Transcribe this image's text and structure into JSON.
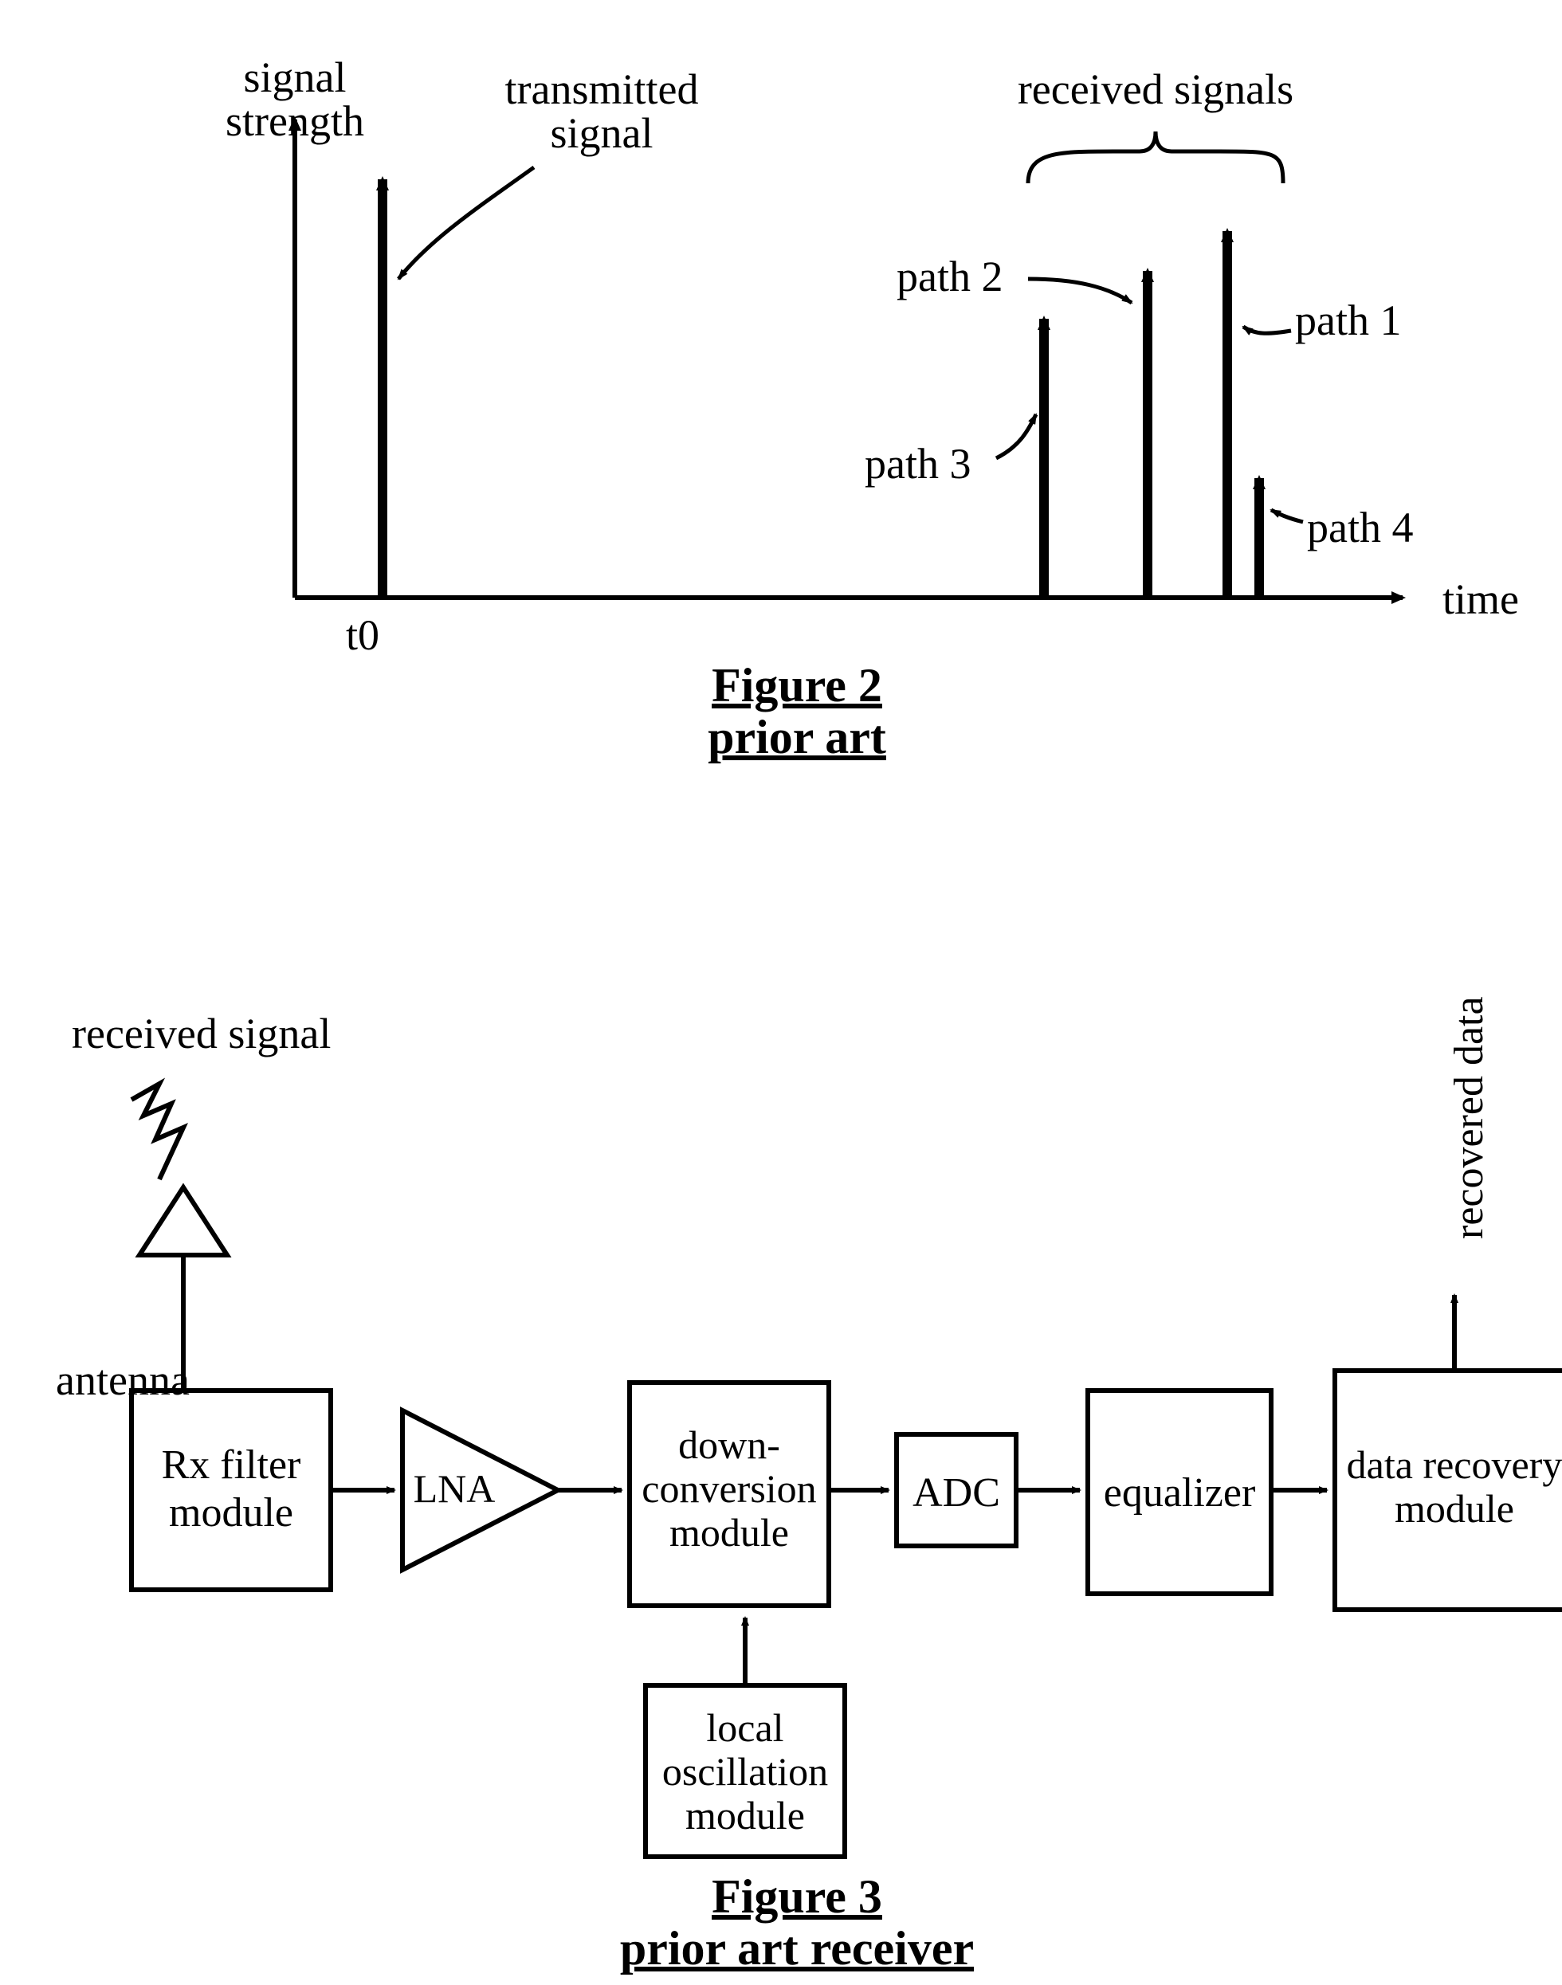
{
  "fig2": {
    "title_line1": "Figure 2",
    "title_line2": "prior art",
    "y_axis_label_line1": "signal",
    "y_axis_label_line2": "strength",
    "x_axis_label": "time",
    "t0": "t0",
    "transmitted_line1": "transmitted",
    "transmitted_line2": "signal",
    "received_label": "received signals",
    "path1": "path 1",
    "path2": "path 2",
    "path3": "path 3",
    "path4": "path 4"
  },
  "fig3": {
    "title_line1": "Figure 3",
    "title_line2": "prior art receiver",
    "received_signal": "received signal",
    "antenna": "antenna",
    "rx_filter_line1": "Rx filter",
    "rx_filter_line2": "module",
    "lna": "LNA",
    "down_conv_line1": "down-",
    "down_conv_line2": "conversion",
    "down_conv_line3": "module",
    "local_osc_line1": "local",
    "local_osc_line2": "oscillation",
    "local_osc_line3": "module",
    "adc": "ADC",
    "equalizer": "equalizer",
    "data_recovery_line1": "data recovery",
    "data_recovery_line2": "module",
    "recovered_data": "recovered data"
  }
}
